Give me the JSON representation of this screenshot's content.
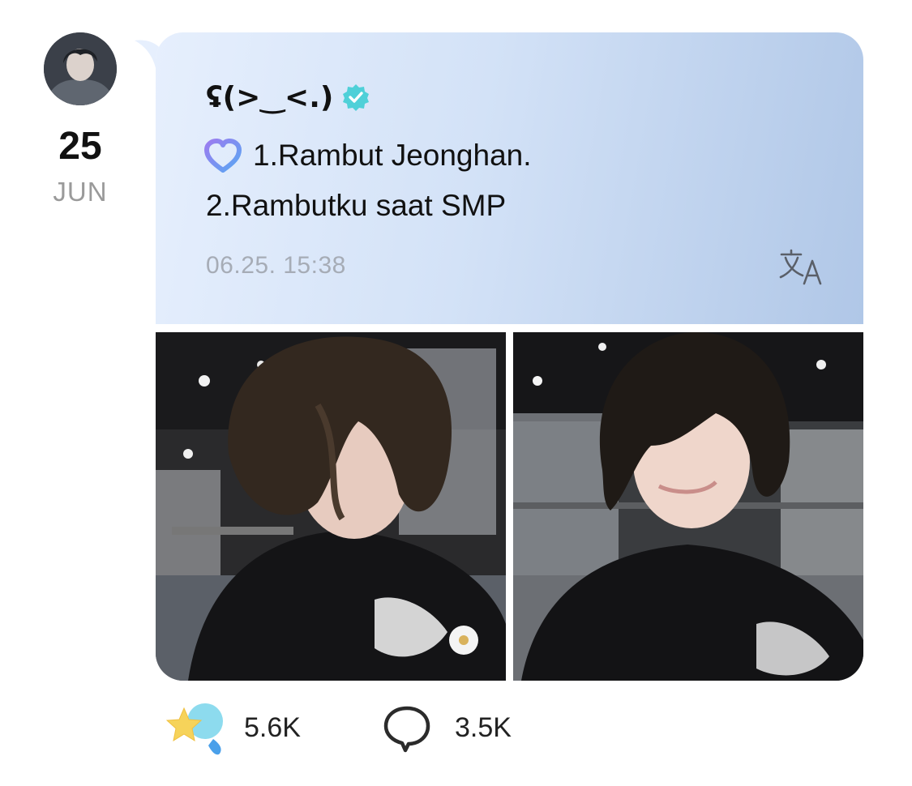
{
  "post": {
    "date_day": "25",
    "date_month": "JUN",
    "author_name": "ʢ(>‿<.)",
    "line1": "1.Rambut Jeonghan.",
    "line2": "2.Rambutku saat SMP",
    "timestamp": "06.25. 15:38",
    "reactions_count": "5.6K",
    "comments_count": "3.5K"
  },
  "icons": {
    "verified": "verified-check-icon",
    "membership": "heart-icon",
    "translate": "translate-icon",
    "reactions": "star-reaction-icon",
    "comments": "comment-bubble-icon"
  },
  "colors": {
    "bubble_start": "#e6effd",
    "bubble_end": "#b0c7e7",
    "verified": "#4fd0d8",
    "muted_text": "#9a9a9a",
    "timestamp": "#a6acb6"
  }
}
